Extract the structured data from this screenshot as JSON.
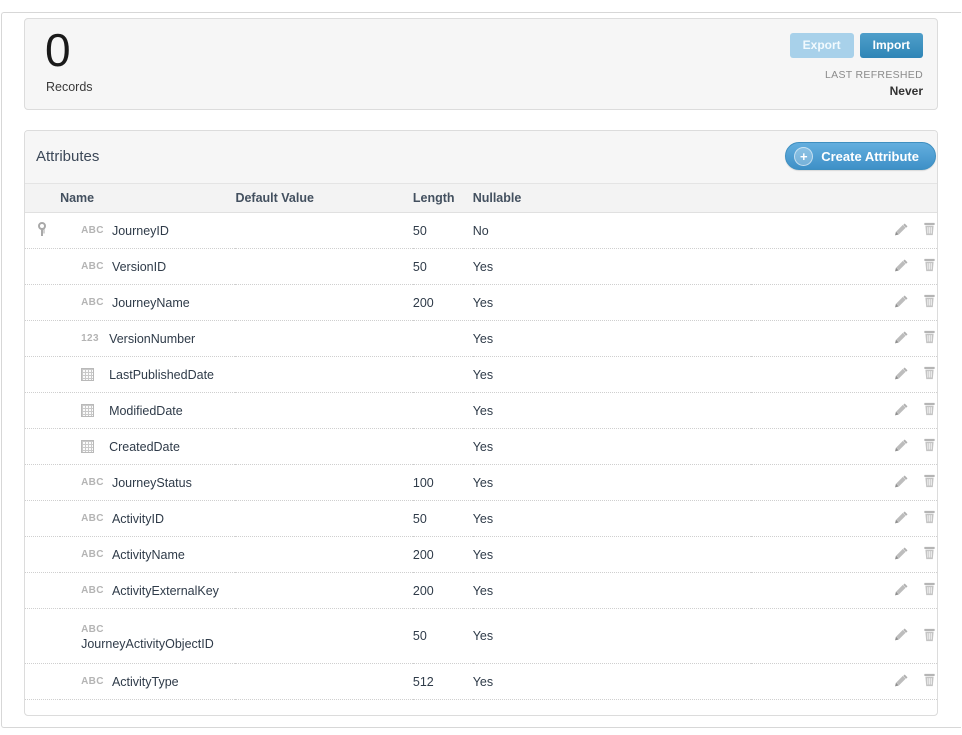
{
  "records_panel": {
    "count": "0",
    "count_label": "Records",
    "export_label": "Export",
    "import_label": "Import",
    "last_refreshed_label": "LAST REFRESHED",
    "last_refreshed_value": "Never"
  },
  "attributes_panel": {
    "title": "Attributes",
    "create_label": "Create Attribute",
    "create_plus": "+",
    "columns": {
      "key": "",
      "name": "Name",
      "default_value": "Default Value",
      "length": "Length",
      "nullable": "Nullable",
      "actions": ""
    },
    "row_icons": {
      "edit": "pencil-icon",
      "delete": "trash-icon",
      "primary_key": "key-icon"
    },
    "rows": [
      {
        "primary_key": true,
        "type": "text",
        "type_label": "ABC",
        "name": "JourneyID",
        "default_value": "",
        "length": "50",
        "nullable": "No",
        "wrapped": false
      },
      {
        "primary_key": false,
        "type": "text",
        "type_label": "ABC",
        "name": "VersionID",
        "default_value": "",
        "length": "50",
        "nullable": "Yes",
        "wrapped": false
      },
      {
        "primary_key": false,
        "type": "text",
        "type_label": "ABC",
        "name": "JourneyName",
        "default_value": "",
        "length": "200",
        "nullable": "Yes",
        "wrapped": false
      },
      {
        "primary_key": false,
        "type": "number",
        "type_label": "123",
        "name": "VersionNumber",
        "default_value": "",
        "length": "",
        "nullable": "Yes",
        "wrapped": false
      },
      {
        "primary_key": false,
        "type": "date",
        "type_label": "",
        "name": "LastPublishedDate",
        "default_value": "",
        "length": "",
        "nullable": "Yes",
        "wrapped": false
      },
      {
        "primary_key": false,
        "type": "date",
        "type_label": "",
        "name": "ModifiedDate",
        "default_value": "",
        "length": "",
        "nullable": "Yes",
        "wrapped": false
      },
      {
        "primary_key": false,
        "type": "date",
        "type_label": "",
        "name": "CreatedDate",
        "default_value": "",
        "length": "",
        "nullable": "Yes",
        "wrapped": false
      },
      {
        "primary_key": false,
        "type": "text",
        "type_label": "ABC",
        "name": "JourneyStatus",
        "default_value": "",
        "length": "100",
        "nullable": "Yes",
        "wrapped": false
      },
      {
        "primary_key": false,
        "type": "text",
        "type_label": "ABC",
        "name": "ActivityID",
        "default_value": "",
        "length": "50",
        "nullable": "Yes",
        "wrapped": false
      },
      {
        "primary_key": false,
        "type": "text",
        "type_label": "ABC",
        "name": "ActivityName",
        "default_value": "",
        "length": "200",
        "nullable": "Yes",
        "wrapped": false
      },
      {
        "primary_key": false,
        "type": "text",
        "type_label": "ABC",
        "name": "ActivityExternalKey",
        "default_value": "",
        "length": "200",
        "nullable": "Yes",
        "wrapped": false
      },
      {
        "primary_key": false,
        "type": "text",
        "type_label": "ABC",
        "name": "JourneyActivityObjectID",
        "default_value": "",
        "length": "50",
        "nullable": "Yes",
        "wrapped": true
      },
      {
        "primary_key": false,
        "type": "text",
        "type_label": "ABC",
        "name": "ActivityType",
        "default_value": "",
        "length": "512",
        "nullable": "Yes",
        "wrapped": false
      }
    ]
  },
  "colors": {
    "accent_blue": "#3c8dbc",
    "disabled_blue": "#a8d1ea",
    "panel_bg": "#f6f6f6",
    "border": "#dcdcdc",
    "icon_gray": "#b4b4b4"
  }
}
